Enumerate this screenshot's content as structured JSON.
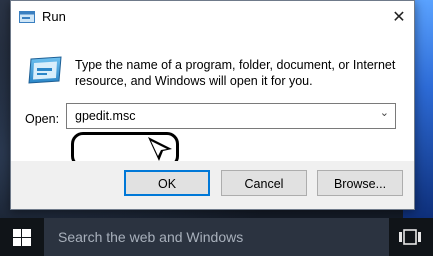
{
  "window": {
    "title": "Run",
    "close_glyph": "✕",
    "description": "Type the name of a program, folder, document, or Internet resource, and Windows will open it for you.",
    "open_label": "Open:",
    "open_value": "gpedit.msc",
    "dropdown_glyph": "⌄",
    "buttons": {
      "ok": "OK",
      "cancel": "Cancel",
      "browse": "Browse..."
    }
  },
  "taskbar": {
    "search_placeholder": "Search the web and Windows"
  },
  "colors": {
    "accent": "#0078d7",
    "taskbar": "#101418",
    "search_bg": "#2b3340"
  },
  "icons": [
    "run-app-icon",
    "close-icon",
    "chevron-down-icon",
    "windows-logo-icon",
    "task-view-icon",
    "pointer-arrow-icon"
  ]
}
